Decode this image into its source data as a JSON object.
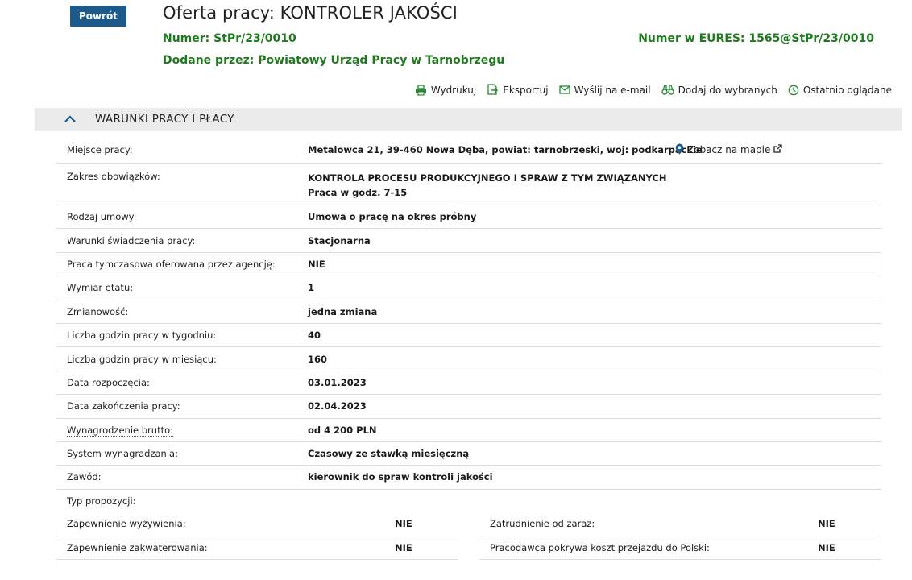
{
  "header": {
    "back_label": "Powrót",
    "title": "Oferta pracy: KONTROLER JAKOŚCI",
    "number_label": "Numer:",
    "number_value": "StPr/23/0010",
    "added_label": "Dodane przez:",
    "added_value": "Powiatowy Urząd Pracy w Tarnobrzegu",
    "eures_label": "Numer w EURES:",
    "eures_value": "1565@StPr/23/0010"
  },
  "actions": [
    {
      "label": "Wydrukuj",
      "icon": "printer-icon"
    },
    {
      "label": "Eksportuj",
      "icon": "export-icon"
    },
    {
      "label": "Wyślij na e-mail",
      "icon": "envelope-icon"
    },
    {
      "label": "Dodaj do wybranych",
      "icon": "binoculars-icon"
    },
    {
      "label": "Ostatnio oglądane",
      "icon": "clock-icon"
    }
  ],
  "section": {
    "title": "WARUNKI PRACY I PŁACY"
  },
  "details": {
    "place_label": "Miejsce pracy:",
    "place_value": "Metalowca 21, 39-460 Nowa Dęba, powiat: tarnobrzeski, woj: podkarpackie",
    "map_link": "Zobacz na mapie",
    "duties_label": "Zakres obowiązków:",
    "duties_line1": "KONTROLA PROCESU PRODUKCYJNEGO I SPRAW Z TYM ZWIĄZANYCH",
    "duties_line2": "Praca w godz. 7-15",
    "rows": [
      {
        "label": "Rodzaj umowy:",
        "value": "Umowa o pracę na okres próbny"
      },
      {
        "label": "Warunki świadczenia pracy:",
        "value": "Stacjonarna"
      },
      {
        "label": "Praca tymczasowa oferowana przez agencję:",
        "value": "NIE"
      },
      {
        "label": "Wymiar etatu:",
        "value": "1"
      },
      {
        "label": "Zmianowość:",
        "value": "jedna zmiana"
      },
      {
        "label": "Liczba godzin pracy w tygodniu:",
        "value": "40"
      },
      {
        "label": "Liczba godzin pracy w miesiącu:",
        "value": "160"
      },
      {
        "label": "Data rozpoczęcia:",
        "value": "03.01.2023"
      },
      {
        "label": "Data zakończenia pracy:",
        "value": "02.04.2023"
      },
      {
        "label": "Wynagrodzenie brutto:",
        "value": "od 4 200 PLN"
      },
      {
        "label": "System wynagradzania:",
        "value": "Czasowy ze stawką miesięczną"
      },
      {
        "label": "Zawód:",
        "value": "kierownik do spraw kontroli jakości"
      }
    ],
    "proposal_type_label": "Typ propozycji:",
    "proposal": {
      "food_label": "Zapewnienie wyżywienia:",
      "food_value": "NIE",
      "immediate_label": "Zatrudnienie od zaraz:",
      "immediate_value": "NIE",
      "housing_label": "Zapewnienie zakwaterowania:",
      "housing_value": "NIE",
      "travel_label": "Pracodawca pokrywa koszt przejazdu do Polski:",
      "travel_value": "NIE"
    }
  }
}
